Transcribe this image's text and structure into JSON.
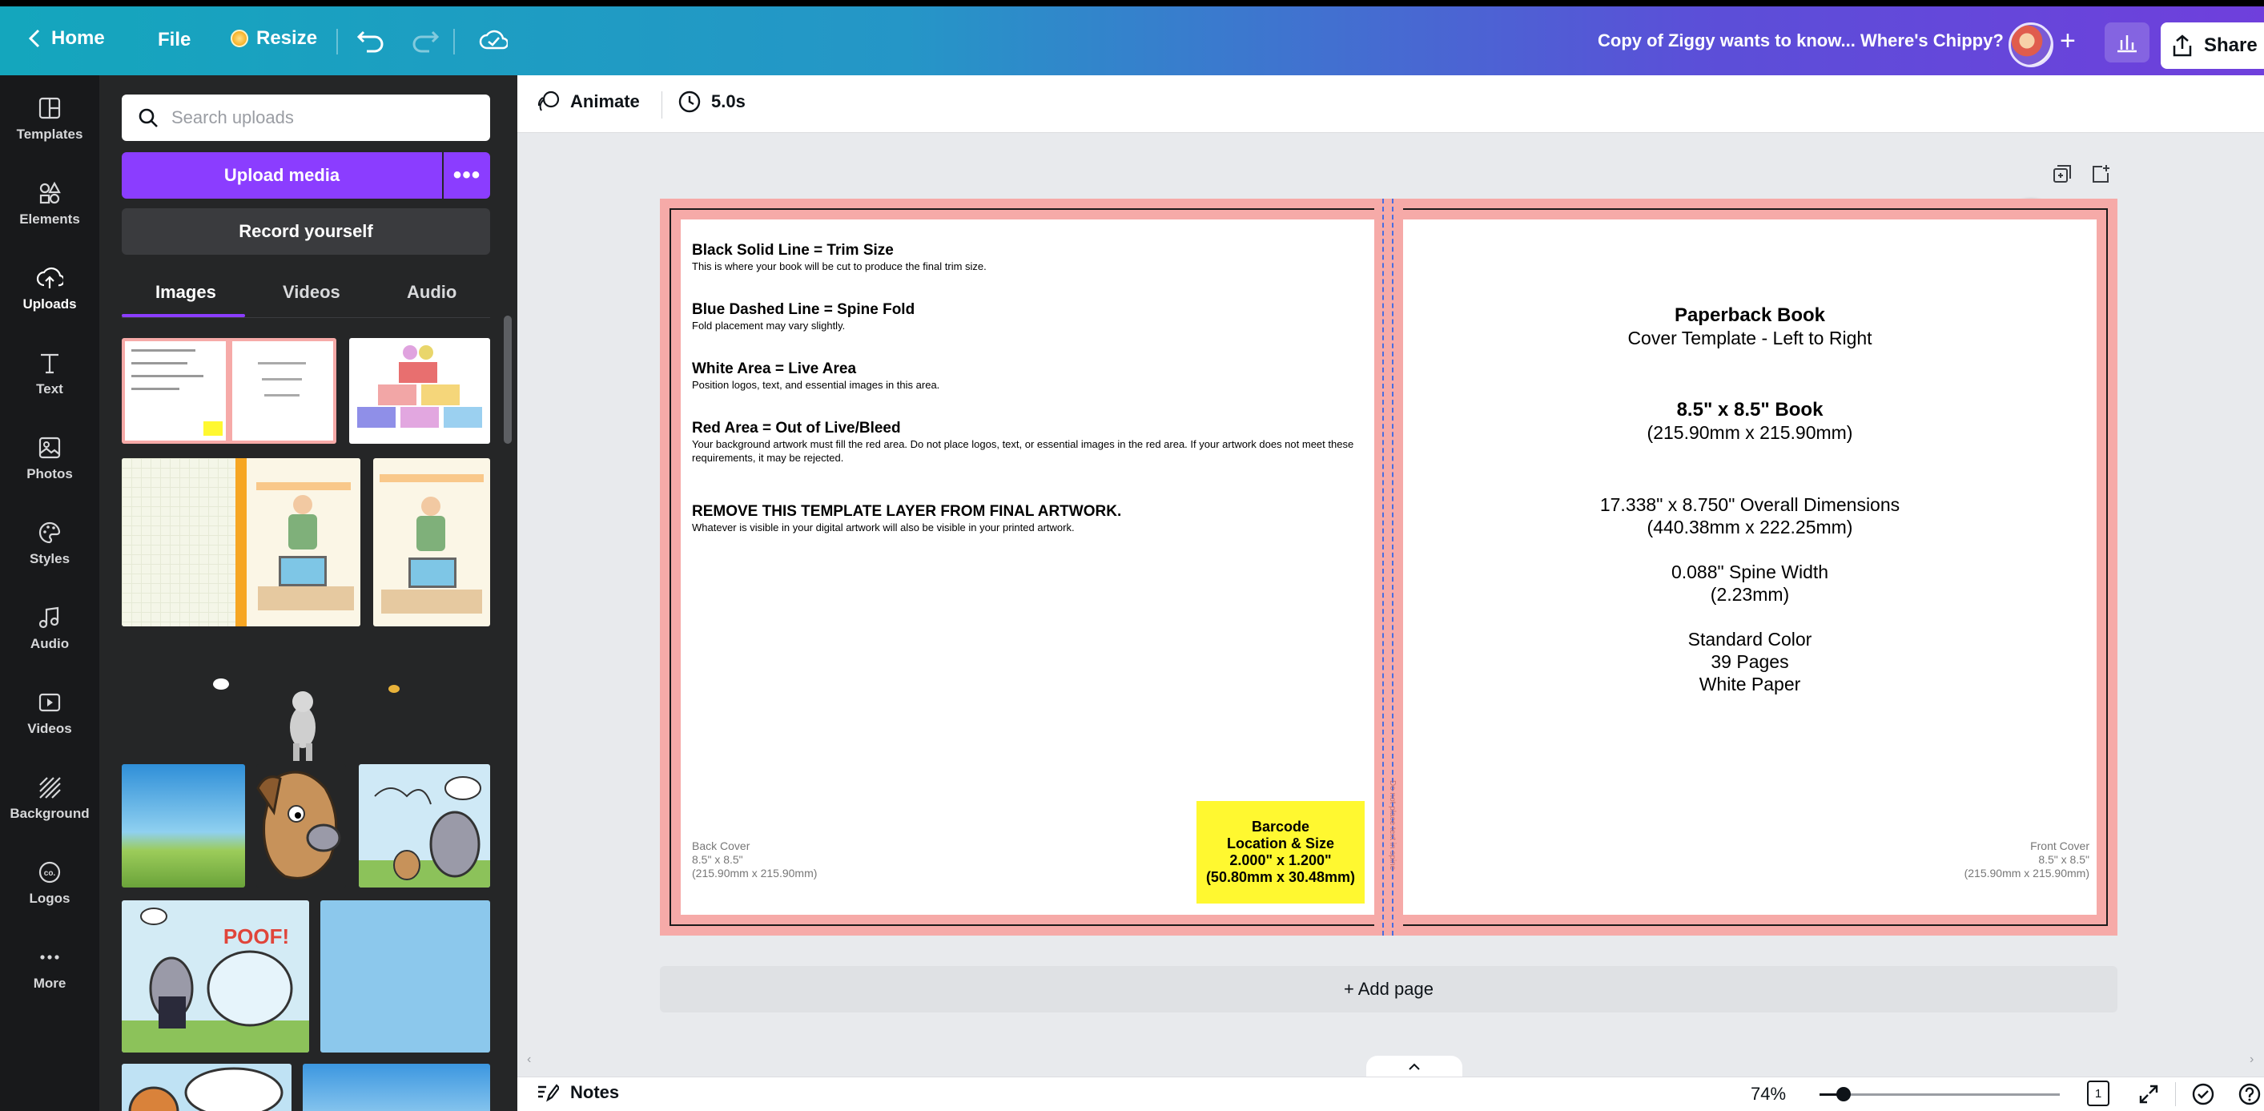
{
  "topbar": {
    "home_label": "Home",
    "file_label": "File",
    "resize_label": "Resize",
    "title": "Copy of Ziggy wants to know... Where's Chippy?",
    "add_label": "+",
    "share_label": "Share"
  },
  "rail": {
    "items": [
      {
        "label": "Templates",
        "icon": "templates-icon"
      },
      {
        "label": "Elements",
        "icon": "elements-icon"
      },
      {
        "label": "Uploads",
        "icon": "uploads-icon",
        "active": true
      },
      {
        "label": "Text",
        "icon": "text-icon"
      },
      {
        "label": "Photos",
        "icon": "photos-icon"
      },
      {
        "label": "Styles",
        "icon": "styles-icon"
      },
      {
        "label": "Audio",
        "icon": "audio-icon"
      },
      {
        "label": "Videos",
        "icon": "videos-icon"
      },
      {
        "label": "Background",
        "icon": "background-icon"
      },
      {
        "label": "Logos",
        "icon": "logos-icon"
      },
      {
        "label": "More",
        "icon": "more-icon"
      }
    ]
  },
  "panel": {
    "search_placeholder": "Search uploads",
    "upload_label": "Upload media",
    "more_label": "•••",
    "record_label": "Record yourself",
    "tabs": [
      "Images",
      "Videos",
      "Audio"
    ],
    "active_tab": "Images",
    "thumb_poof_text": "POOF!"
  },
  "editor": {
    "animate_label": "Animate",
    "duration": "5.0s",
    "add_page_label": "+ Add page",
    "notes_label": "Notes",
    "zoom": "74%",
    "zoom_value": 0.1,
    "page_count": "1"
  },
  "template": {
    "guides": [
      {
        "title": "Black Solid Line = Trim Size",
        "body": "This is where your book will be cut to produce the final trim size."
      },
      {
        "title": "Blue Dashed Line = Spine Fold",
        "body": "Fold placement may vary slightly."
      },
      {
        "title": "White Area = Live Area",
        "body": "Position logos, text, and essential images in this area."
      },
      {
        "title": "Red Area = Out of Live/Bleed",
        "body": "Your background artwork must fill the red area. Do not place logos, text, or essential images in the red area. If your artwork does not meet these requirements, it may be rejected."
      },
      {
        "title": "REMOVE THIS TEMPLATE LAYER FROM FINAL ARTWORK.",
        "body": "Whatever is visible in your digital artwork will also be visible in your printed artwork."
      }
    ],
    "back_cover": [
      "Back Cover",
      "8.5\" x 8.5\"",
      "(215.90mm x 215.90mm)"
    ],
    "barcode": [
      "Barcode",
      "Location & Size",
      "2.000\" x 1.200\"",
      "(50.80mm x 30.48mm)"
    ],
    "front_cover": [
      "Front Cover",
      "8.5\" x 8.5\"",
      "(215.90mm x 215.90mm)"
    ],
    "spine_text": "Do not place text in spine",
    "cover_info": {
      "title": "Paperback Book",
      "subtitle": "Cover Template - Left to Right",
      "size": "8.5\" x 8.5\" Book",
      "size_mm": "(215.90mm x 215.90mm)",
      "overall": "17.338\" x 8.750\" Overall Dimensions",
      "overall_mm": "(440.38mm x 222.25mm)",
      "spine": "0.088\" Spine Width",
      "spine_mm": "(2.23mm)",
      "color": "Standard Color",
      "pages": "39 Pages",
      "paper": "White Paper"
    }
  },
  "colors": {
    "accent": "#8b3dff",
    "bleed": "#f6aaa8",
    "barcode": "#fff830",
    "spine_fold": "#4a6ee0"
  }
}
